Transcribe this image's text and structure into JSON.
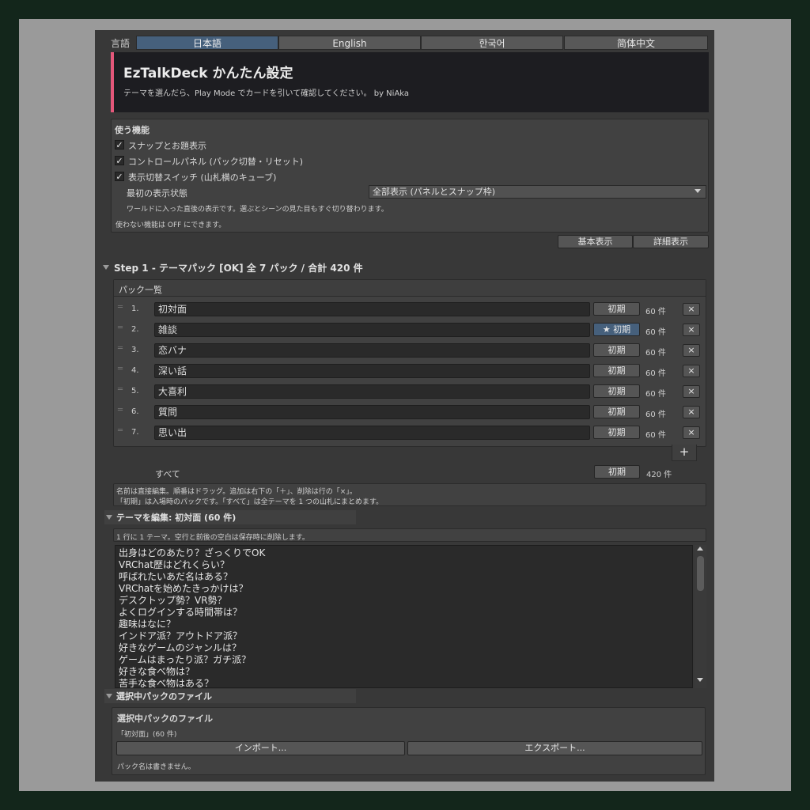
{
  "language": {
    "label": "言語",
    "tabs": [
      "日本語",
      "English",
      "한국어",
      "简体中文"
    ],
    "active_index": 0
  },
  "header": {
    "title": "EzTalkDeck かんたん設定",
    "subtitle": "テーマを選んだら、Play Mode でカードを引いて確認してください。 by NiAka",
    "accent_color": "#e4577a"
  },
  "features": {
    "title": "使う機能",
    "checkboxes": [
      {
        "label": "スナップとお題表示",
        "checked": true
      },
      {
        "label": "コントロールパネル (パック切替・リセット)",
        "checked": true
      },
      {
        "label": "表示切替スイッチ (山札横のキューブ)",
        "checked": true
      }
    ],
    "initial_display_label": "最初の表示状態",
    "initial_display_value": "全部表示 (パネルとスナップ枠)",
    "initial_display_hint": "ワールドに入った直後の表示です。選ぶとシーンの見た目もすぐ切り替わります。",
    "footer_note": "使わない機能は OFF にできます。"
  },
  "view_buttons": {
    "basic": "基本表示",
    "detail": "詳細表示"
  },
  "step1": {
    "title": "Step 1 - テーマパック [OK] 全 7 パック / 合計 420 件",
    "list_header": "パック一覧",
    "handle_glyph": "═",
    "default_label": "初期",
    "default_label_starred": "★ 初期",
    "remove_glyph": "×",
    "add_glyph": "+",
    "packs": [
      {
        "num": "1.",
        "name": "初対面",
        "count": "60 件",
        "is_default": false
      },
      {
        "num": "2.",
        "name": "雑談",
        "count": "60 件",
        "is_default": true
      },
      {
        "num": "3.",
        "name": "恋バナ",
        "count": "60 件",
        "is_default": false
      },
      {
        "num": "4.",
        "name": "深い話",
        "count": "60 件",
        "is_default": false
      },
      {
        "num": "5.",
        "name": "大喜利",
        "count": "60 件",
        "is_default": false
      },
      {
        "num": "6.",
        "name": "質問",
        "count": "60 件",
        "is_default": false
      },
      {
        "num": "7.",
        "name": "思い出",
        "count": "60 件",
        "is_default": false
      }
    ],
    "all_label": "すべて",
    "all_default": "初期",
    "all_count": "420 件",
    "help_line1": "名前は直接編集。順番はドラッグ。追加は右下の「＋」、削除は行の「×」。",
    "help_line2": "「初期」は入場時のパックです。「すべて」は全テーマを 1 つの山札にまとめます。"
  },
  "theme_edit": {
    "title": "テーマを編集: 初対面 (60 件)",
    "hint": "1 行に 1 テーマ。空行と前後の空白は保存時に削除します。",
    "lines": [
      "出身はどのあたり？ざっくりでOK",
      "VRChat歴はどれくらい？",
      "呼ばれたいあだ名はある？",
      "VRChatを始めたきっかけは？",
      "デスクトップ勢？VR勢？",
      "よくログインする時間帯は？",
      "趣味はなに？",
      "インドア派？アウトドア派？",
      "好きなゲームのジャンルは？",
      "ゲームはまったり派？ガチ派？",
      "好きな食べ物は？",
      "苦手な食べ物はある？"
    ]
  },
  "selected_file": {
    "section_title": "選択中パックのファイル",
    "box_title": "選択中パックのファイル",
    "pack_info": "「初対面」(60 件)",
    "import_label": "インポート...",
    "export_label": "エクスポート...",
    "note": "パック名は書きません。"
  }
}
